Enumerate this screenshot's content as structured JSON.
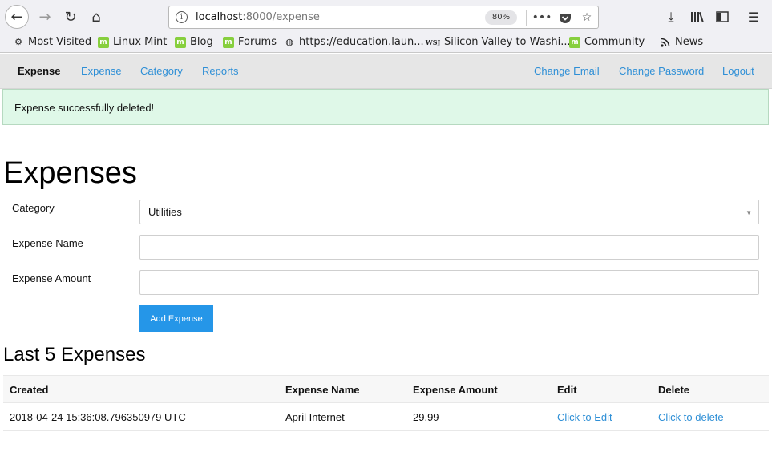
{
  "browser": {
    "url_host": "localhost",
    "url_path": ":8000/expense",
    "zoom": "80%",
    "bookmarks": [
      {
        "label": "Most Visited",
        "icon": "gear-icon"
      },
      {
        "label": "Linux Mint",
        "icon": "mint-icon"
      },
      {
        "label": "Blog",
        "icon": "mint-icon"
      },
      {
        "label": "Forums",
        "icon": "mint-icon"
      },
      {
        "label": "https://education.laun...",
        "icon": "globe-icon"
      },
      {
        "label": "Silicon Valley to Washi...",
        "icon": "wsj-icon"
      },
      {
        "label": "Community",
        "icon": "mint-icon"
      },
      {
        "label": "News",
        "icon": "rss-icon"
      }
    ]
  },
  "nav": {
    "brand": "Expense",
    "links_left": [
      "Expense",
      "Category",
      "Reports"
    ],
    "links_right": [
      "Change Email",
      "Change Password",
      "Logout"
    ]
  },
  "alert": {
    "message": "Expense successfully deleted!"
  },
  "form": {
    "title": "Expenses",
    "category_label": "Category",
    "category_value": "Utilities",
    "name_label": "Expense Name",
    "name_value": "",
    "amount_label": "Expense Amount",
    "amount_value": "",
    "submit_label": "Add Expense"
  },
  "recent": {
    "title": "Last 5 Expenses",
    "columns": [
      "Created",
      "Expense Name",
      "Expense Amount",
      "Edit",
      "Delete"
    ],
    "rows": [
      {
        "created": "2018-04-24 15:36:08.796350979 UTC",
        "name": "April Internet",
        "amount": "29.99",
        "edit": "Click to Edit",
        "delete": "Click to delete"
      }
    ]
  }
}
